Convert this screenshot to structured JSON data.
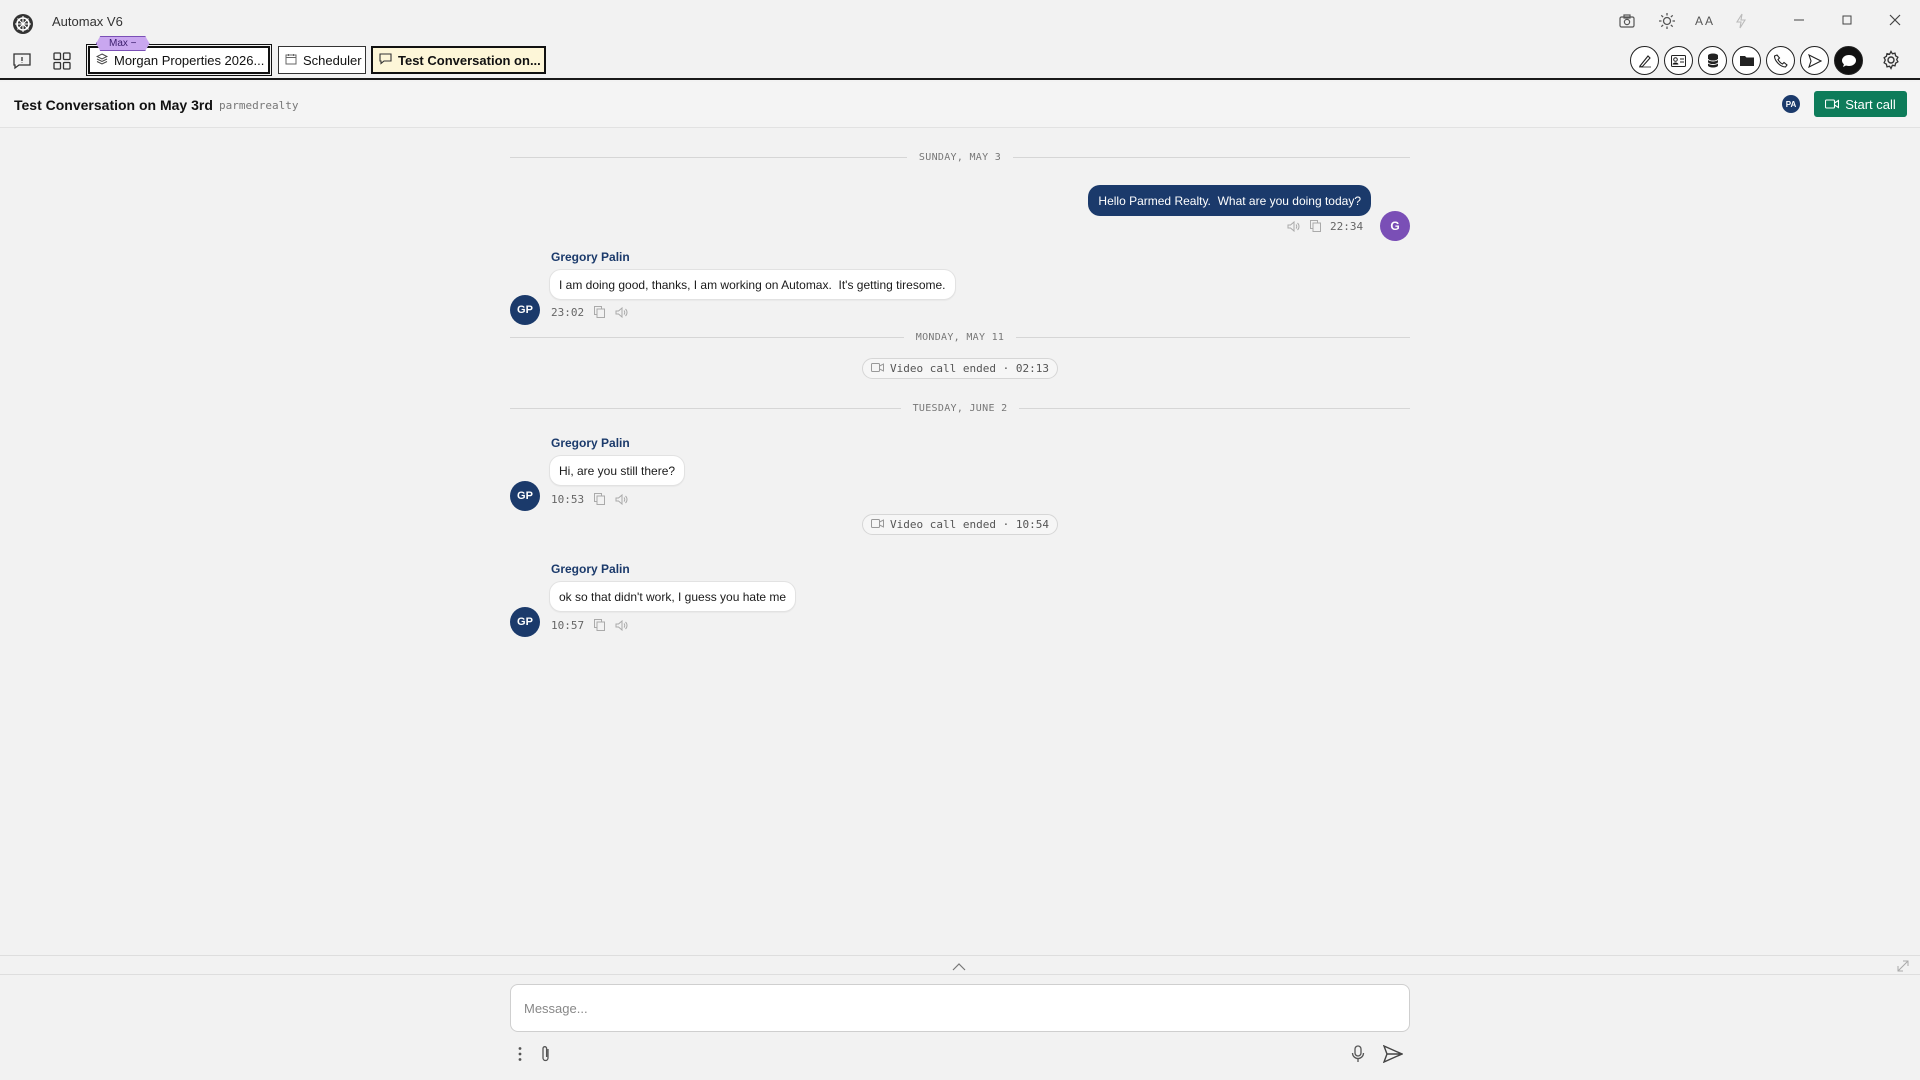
{
  "app": {
    "title": "Automax V6",
    "logo_icon": "automax-logo-icon"
  },
  "titlebar": {
    "icons": [
      "camera-icon",
      "brightness-icon",
      "font-size-icon",
      "lightning-icon"
    ],
    "font_size_glyph": "A A"
  },
  "tabs": [
    {
      "label": "Morgan Properties 2026...",
      "icon": "stack-icon",
      "badge": "Max  −"
    },
    {
      "label": "Scheduler",
      "icon": "calendar-icon"
    },
    {
      "label": "Test Conversation on...",
      "icon": "chat-icon",
      "active": true
    }
  ],
  "toolbar_right": [
    "signature-icon",
    "contact-card-icon",
    "database-icon",
    "folder-icon",
    "phone-icon",
    "send-icon",
    "chat-bubble-icon",
    "settings-icon"
  ],
  "conversation": {
    "title": "Test Conversation on May 3rd",
    "handle": "parmedrealty",
    "participant_initials": "PA",
    "start_call_label": "Start call"
  },
  "messages": {
    "day1": "SUNDAY, MAY 3",
    "out1": {
      "text": "Hello Parmed Realty.  What are you doing today?",
      "time": "22:34",
      "avatar": "G"
    },
    "in1": {
      "sender": "Gregory Palin",
      "text": "I am doing good, thanks, I am working on Automax.  It's getting tiresome.",
      "time": "23:02",
      "avatar": "GP"
    },
    "day2": "MONDAY, MAY 11",
    "sys1": "Video call ended · 02:13",
    "day3": "TUESDAY, JUNE 2",
    "in2": {
      "sender": "Gregory Palin",
      "text": "Hi, are you still there?",
      "time": "10:53",
      "avatar": "GP"
    },
    "sys2": "Video call ended · 10:54",
    "in3": {
      "sender": "Gregory Palin",
      "text": "ok so that didn't work, I guess you hate me",
      "time": "10:57",
      "avatar": "GP"
    }
  },
  "composer": {
    "placeholder": "Message...",
    "value": ""
  },
  "colors": {
    "accent": "#1b3a6b",
    "call_button": "#0e7c5a",
    "user_avatar": "#7a4fb6",
    "badge": "#c9a7ef",
    "active_tab": "#fdf6d8"
  }
}
